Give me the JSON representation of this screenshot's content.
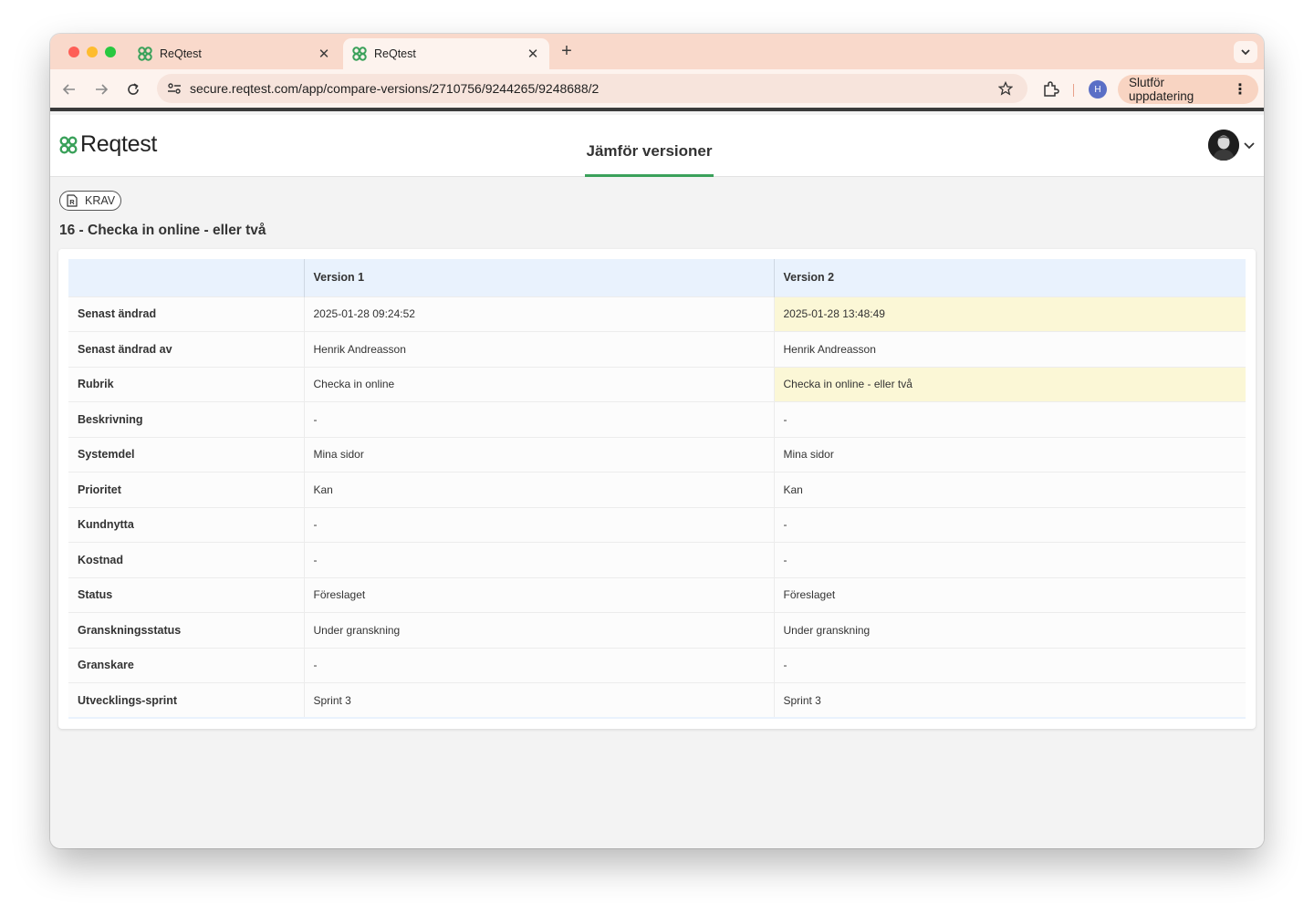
{
  "browser": {
    "tabs": [
      {
        "title": "ReQtest",
        "close": "✕"
      },
      {
        "title": "ReQtest",
        "close": "✕"
      }
    ],
    "new_tab": "+",
    "url": "secure.reqtest.com/app/compare-versions/2710756/9244265/9248688/2",
    "profile_initial": "H",
    "update_label": "Slutför uppdatering",
    "colors": {
      "tabstrip": "#f9d9cb",
      "toolbar": "#fdf3ee",
      "accent_green": "#3aa15a"
    }
  },
  "app": {
    "logo_text": "Reqtest",
    "page_title": "Jämför versioner"
  },
  "item": {
    "type_badge": "KRAV",
    "title": "16 - Checka in online - eller två"
  },
  "compare_table": {
    "headers": [
      "",
      "Version 1",
      "Version 2"
    ],
    "rows": [
      {
        "field": "Senast ändrad",
        "v1": "2025-01-28 09:24:52",
        "v2": "2025-01-28 13:48:49",
        "changed": true
      },
      {
        "field": "Senast ändrad av",
        "v1": "Henrik Andreasson",
        "v2": "Henrik Andreasson",
        "changed": false
      },
      {
        "field": "Rubrik",
        "v1": "Checka in online",
        "v2": "Checka in online - eller två",
        "changed": true
      },
      {
        "field": "Beskrivning",
        "v1": "-",
        "v2": "-",
        "changed": false
      },
      {
        "field": "Systemdel",
        "v1": "Mina sidor",
        "v2": "Mina sidor",
        "changed": false
      },
      {
        "field": "Prioritet",
        "v1": "Kan",
        "v2": "Kan",
        "changed": false
      },
      {
        "field": "Kundnytta",
        "v1": "-",
        "v2": "-",
        "changed": false
      },
      {
        "field": "Kostnad",
        "v1": "-",
        "v2": "-",
        "changed": false
      },
      {
        "field": "Status",
        "v1": "Föreslaget",
        "v2": "Föreslaget",
        "changed": false
      },
      {
        "field": "Granskningsstatus",
        "v1": "Under granskning",
        "v2": "Under granskning",
        "changed": false
      },
      {
        "field": "Granskare",
        "v1": "-",
        "v2": "-",
        "changed": false
      },
      {
        "field": "Utvecklings-sprint",
        "v1": "Sprint 3",
        "v2": "Sprint 3",
        "changed": false
      }
    ]
  }
}
